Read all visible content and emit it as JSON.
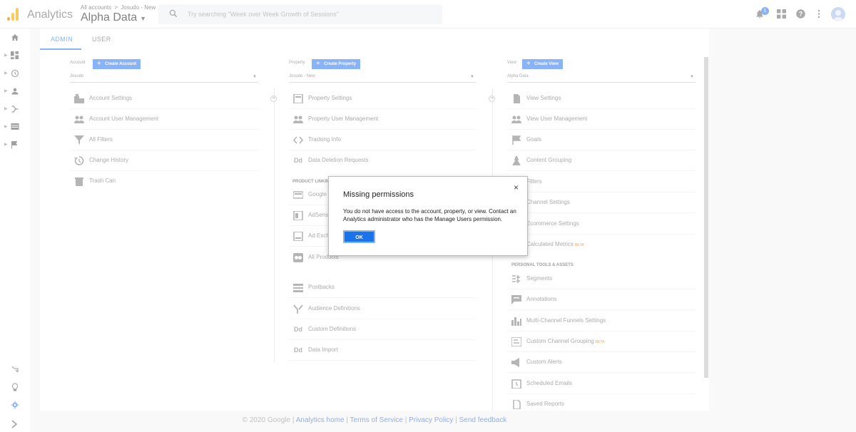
{
  "header": {
    "app_name": "Analytics",
    "breadcrumb": {
      "root": "All accounts",
      "sep": ">",
      "current": "Josudo - New"
    },
    "account_title": "Alpha Data",
    "search_placeholder": "Try searching \"Week over Week Growth of Sessions\"",
    "notification_count": "1",
    "icons": [
      "bell-icon",
      "apps-icon",
      "help-icon",
      "more-vert-icon"
    ],
    "logo_colors": [
      "#f9ab00",
      "#e37400"
    ]
  },
  "leftnav": {
    "top_items": [
      "home-icon",
      "customization-icon",
      "realtime-icon",
      "audience-icon",
      "acquisition-icon",
      "behavior-icon",
      "conversions-icon"
    ],
    "bottom_items": [
      "attribution-icon",
      "discover-icon",
      "admin-gear-icon",
      "expand-icon"
    ]
  },
  "tabs": [
    {
      "label": "ADMIN",
      "active": true
    },
    {
      "label": "USER",
      "active": false
    }
  ],
  "columns": {
    "account": {
      "label": "Account",
      "button": "Create Account",
      "selected": "Josudo",
      "items": [
        {
          "label": "Account Settings",
          "icon": "building-icon"
        },
        {
          "label": "Account User Management",
          "icon": "people-icon"
        },
        {
          "label": "All Filters",
          "icon": "filter-icon"
        },
        {
          "label": "Change History",
          "icon": "history-icon"
        },
        {
          "label": "Trash Can",
          "icon": "trash-icon"
        }
      ]
    },
    "property": {
      "label": "Property",
      "button": "Create Property",
      "selected": "Josudo - New",
      "items": [
        {
          "label": "Property Settings",
          "icon": "square-icon"
        },
        {
          "label": "Property User Management",
          "icon": "people-icon"
        },
        {
          "label": "Tracking Info",
          "icon": "code-icon"
        },
        {
          "label": "Data Deletion Requests",
          "icon": "dd-icon"
        }
      ],
      "section": "PRODUCT LINKING",
      "linking": [
        {
          "label": "Google",
          "icon": "ads-icon"
        },
        {
          "label": "AdSense",
          "icon": "adsense-icon"
        },
        {
          "label": "Ad Exch",
          "icon": "adexchange-icon"
        },
        {
          "label": "All Products",
          "icon": "products-icon"
        }
      ],
      "more": [
        {
          "label": "Postbacks",
          "icon": "postbacks-icon"
        },
        {
          "label": "Audience Definitions",
          "icon": "audience-definitions-icon"
        },
        {
          "label": "Custom Definitions",
          "icon": "dd-icon"
        },
        {
          "label": "Data Import",
          "icon": "dd-icon"
        }
      ]
    },
    "view": {
      "label": "View",
      "button": "Create View",
      "selected": "Alpha Data",
      "items": [
        {
          "label": "View Settings",
          "icon": "document-icon"
        },
        {
          "label": "View User Management",
          "icon": "people-icon"
        },
        {
          "label": "Goals",
          "icon": "flag-icon"
        },
        {
          "label": "Content Grouping",
          "icon": "content-grouping-icon"
        },
        {
          "label": "Filters",
          "icon": "filter-icon"
        },
        {
          "label": "Channel Settings",
          "icon": "channel-icon"
        },
        {
          "label": "Ecommerce Settings",
          "icon": "cart-icon"
        },
        {
          "label": "Calculated Metrics",
          "icon": "calculator-icon",
          "beta": "BETA"
        }
      ],
      "section": "PERSONAL TOOLS & ASSETS",
      "tools": [
        {
          "label": "Segments",
          "icon": "segments-icon"
        },
        {
          "label": "Annotations",
          "icon": "annotation-icon"
        },
        {
          "label": "Multi-Channel Funnels Settings",
          "icon": "bar-chart-icon"
        },
        {
          "label": "Custom Channel Grouping",
          "icon": "channel-grouping-icon",
          "beta": "BETA"
        },
        {
          "label": "Custom Alerts",
          "icon": "megaphone-icon"
        },
        {
          "label": "Scheduled Emails",
          "icon": "scheduled-icon"
        },
        {
          "label": "Saved Reports",
          "icon": "saved-reports-icon"
        }
      ]
    }
  },
  "modal": {
    "title": "Missing permissions",
    "body": "You do not have access to the account, property, or view. Contact an Analytics administrator who has the Manage Users permission.",
    "ok": "OK",
    "close": "×"
  },
  "footer": {
    "copyright": "© 2020 Google",
    "sep": "|",
    "links": [
      "Analytics home",
      "Terms of Service",
      "Privacy Policy",
      "Send feedback"
    ]
  }
}
